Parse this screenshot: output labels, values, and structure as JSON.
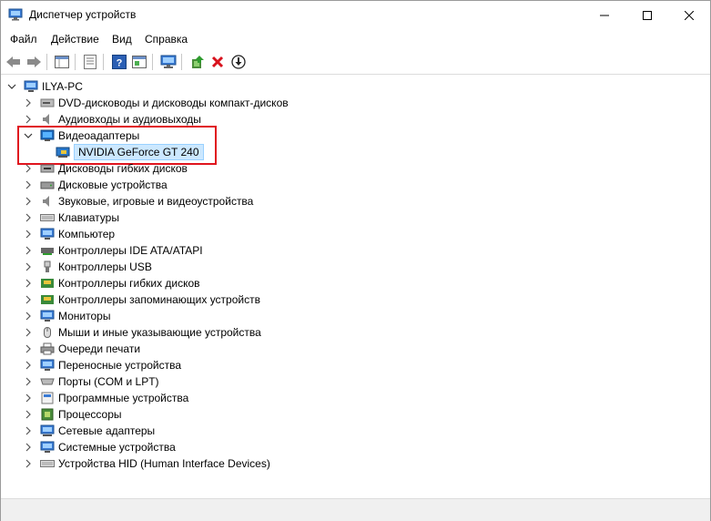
{
  "window": {
    "title": "Диспетчер устройств"
  },
  "menu": [
    "Файл",
    "Действие",
    "Вид",
    "Справка"
  ],
  "toolbar": {
    "buttons": [
      "back-icon",
      "forward-icon",
      "properties-icon",
      "list-icon",
      "help-icon",
      "console-tree-icon",
      "scan-hardware-icon",
      "enable-driver-icon",
      "uninstall-icon",
      "disable-icon"
    ]
  },
  "tree": {
    "root": "ILYA-PC",
    "nodes": [
      {
        "label": "DVD-дисководы и дисководы компакт-дисков",
        "icon": "dvd-icon",
        "expanded": false
      },
      {
        "label": "Аудиовходы и аудиовыходы",
        "icon": "speaker-icon",
        "expanded": false
      },
      {
        "label": "Видеоадаптеры",
        "icon": "display-adapter-icon",
        "expanded": true,
        "children": [
          "NVIDIA GeForce GT 240"
        ]
      },
      {
        "label": "Дисководы гибких дисков",
        "icon": "floppy-drive-icon",
        "expanded": false
      },
      {
        "label": "Дисковые устройства",
        "icon": "disk-drive-icon",
        "expanded": false
      },
      {
        "label": "Звуковые, игровые и видеоустройства",
        "icon": "sound-icon",
        "expanded": false
      },
      {
        "label": "Клавиатуры",
        "icon": "keyboard-icon",
        "expanded": false
      },
      {
        "label": "Компьютер",
        "icon": "computer-icon",
        "expanded": false
      },
      {
        "label": "Контроллеры IDE ATA/ATAPI",
        "icon": "ide-controller-icon",
        "expanded": false
      },
      {
        "label": "Контроллеры USB",
        "icon": "usb-icon",
        "expanded": false
      },
      {
        "label": "Контроллеры гибких дисков",
        "icon": "floppy-controller-icon",
        "expanded": false
      },
      {
        "label": "Контроллеры запоминающих устройств",
        "icon": "storage-controller-icon",
        "expanded": false
      },
      {
        "label": "Мониторы",
        "icon": "monitor-icon",
        "expanded": false
      },
      {
        "label": "Мыши и иные указывающие устройства",
        "icon": "mouse-icon",
        "expanded": false
      },
      {
        "label": "Очереди печати",
        "icon": "printer-icon",
        "expanded": false
      },
      {
        "label": "Переносные устройства",
        "icon": "portable-device-icon",
        "expanded": false
      },
      {
        "label": "Порты (COM и LPT)",
        "icon": "port-icon",
        "expanded": false
      },
      {
        "label": "Программные устройства",
        "icon": "software-device-icon",
        "expanded": false
      },
      {
        "label": "Процессоры",
        "icon": "processor-icon",
        "expanded": false
      },
      {
        "label": "Сетевые адаптеры",
        "icon": "network-adapter-icon",
        "expanded": false
      },
      {
        "label": "Системные устройства",
        "icon": "system-device-icon",
        "expanded": false
      },
      {
        "label": "Устройства HID (Human Interface Devices)",
        "icon": "hid-icon",
        "expanded": false
      }
    ]
  },
  "colors": {
    "selection": "#cce8ff",
    "highlight_box": "#e0141e"
  }
}
